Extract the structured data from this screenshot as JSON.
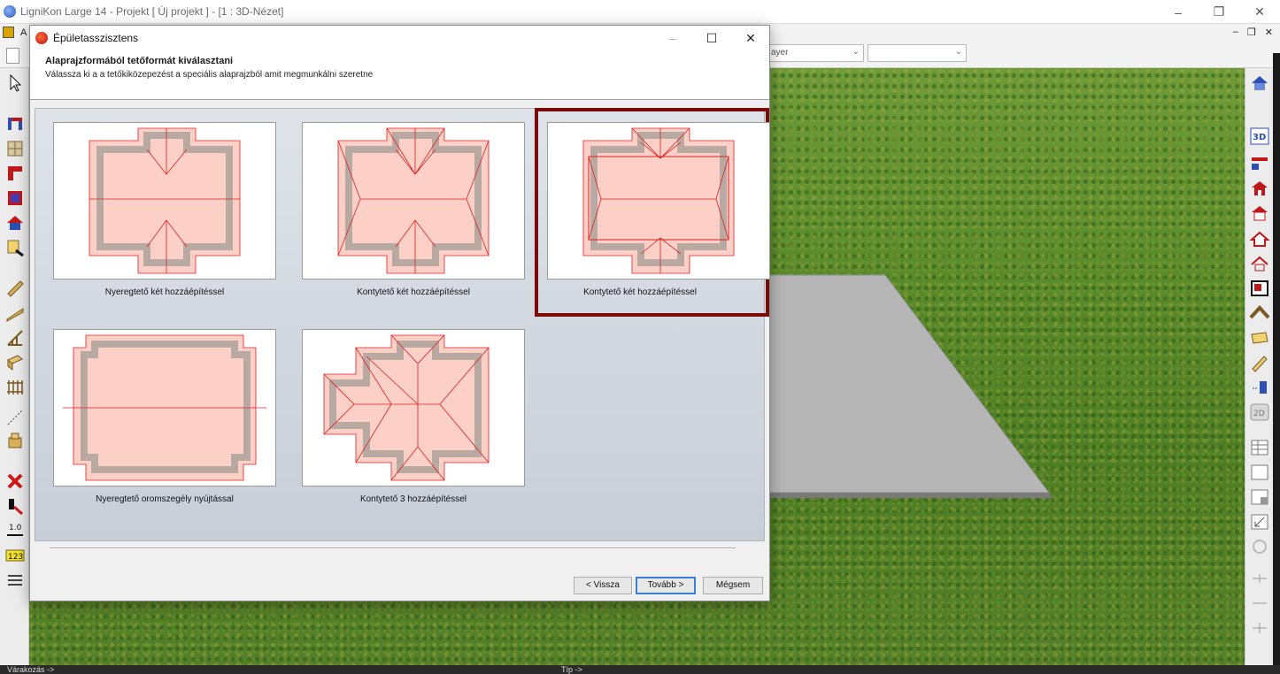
{
  "app": {
    "title": "LigniKon Large 14 - Projekt [ Új projekt ]  - [1 : 3D-Nézet]",
    "menu_first_letter": "A",
    "layer_select_value": "ayer"
  },
  "dialog": {
    "title": "Épületasszisztens",
    "heading": "Alaprajzformából tetőformát kiválasztani",
    "subheading": "Válassza ki a a tetőkiközepezést a speciális alaprajzból amit megmunkálni szeretne",
    "options": [
      {
        "label": "Nyeregtető két hozzáépítéssel",
        "selected": false
      },
      {
        "label": "Kontytető két hozzáépítéssel",
        "selected": false
      },
      {
        "label": "Kontytető két hozzáépítéssel",
        "selected": true
      },
      {
        "label": "Nyeregtető oromszegély nyújtással",
        "selected": false
      },
      {
        "label": "Kontytető 3 hozzáépítéssel",
        "selected": false
      }
    ],
    "buttons": {
      "back": "< Vissza",
      "next": "Tovább >",
      "cancel": "Mégsem"
    }
  },
  "statusbar": {
    "left": "Várakozás ->",
    "center": "Típ ->"
  },
  "colors": {
    "selection_border": "#7a0a0a",
    "roof_fill": "#fcd0c6",
    "roof_line": "#e02020",
    "wall_hatch": "#b9a9a3"
  }
}
